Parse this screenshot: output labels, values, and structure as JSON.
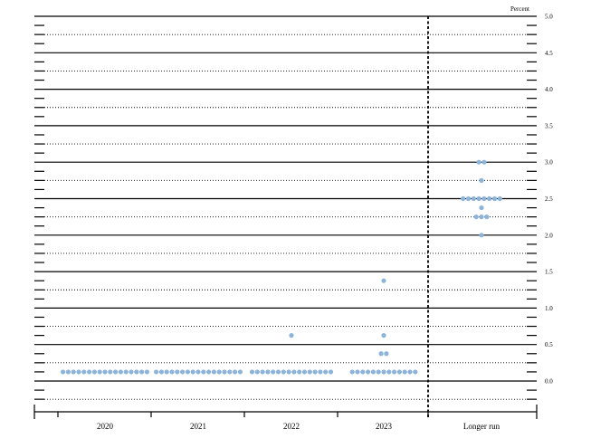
{
  "chart_data": {
    "type": "scatter",
    "unit_label": "Percent",
    "categories": [
      "2020",
      "2021",
      "2022",
      "2023",
      "Longer run"
    ],
    "ylim": [
      -0.25,
      5.0
    ],
    "y_ticks": [
      "5.0",
      "4.5",
      "4.0",
      "3.5",
      "3.0",
      "2.5",
      "2.0",
      "1.5",
      "1.0",
      "0.5",
      "0.0"
    ],
    "y_tick_values": [
      5.0,
      4.5,
      4.0,
      3.5,
      3.0,
      2.5,
      2.0,
      1.5,
      1.0,
      0.5,
      0.0
    ],
    "grid": "solid lines at whole and half-unit levels, dotted lines at quarter-unit levels",
    "separator": "dashed vertical line before Longer run",
    "dot_color": "#8db4d8",
    "series": [
      {
        "category": "2020",
        "points": [
          {
            "y": 0.125,
            "count": 17
          }
        ]
      },
      {
        "category": "2021",
        "points": [
          {
            "y": 0.125,
            "count": 17
          }
        ]
      },
      {
        "category": "2022",
        "points": [
          {
            "y": 0.125,
            "count": 16
          },
          {
            "y": 0.625,
            "count": 1
          }
        ]
      },
      {
        "category": "2023",
        "points": [
          {
            "y": 0.125,
            "count": 13
          },
          {
            "y": 0.375,
            "count": 2
          },
          {
            "y": 0.625,
            "count": 1
          },
          {
            "y": 1.375,
            "count": 1
          }
        ]
      },
      {
        "category": "Longer run",
        "points": [
          {
            "y": 2.0,
            "count": 1
          },
          {
            "y": 2.25,
            "count": 3
          },
          {
            "y": 2.375,
            "count": 1
          },
          {
            "y": 2.5,
            "count": 8
          },
          {
            "y": 2.75,
            "count": 1
          },
          {
            "y": 3.0,
            "count": 2
          }
        ]
      }
    ]
  }
}
